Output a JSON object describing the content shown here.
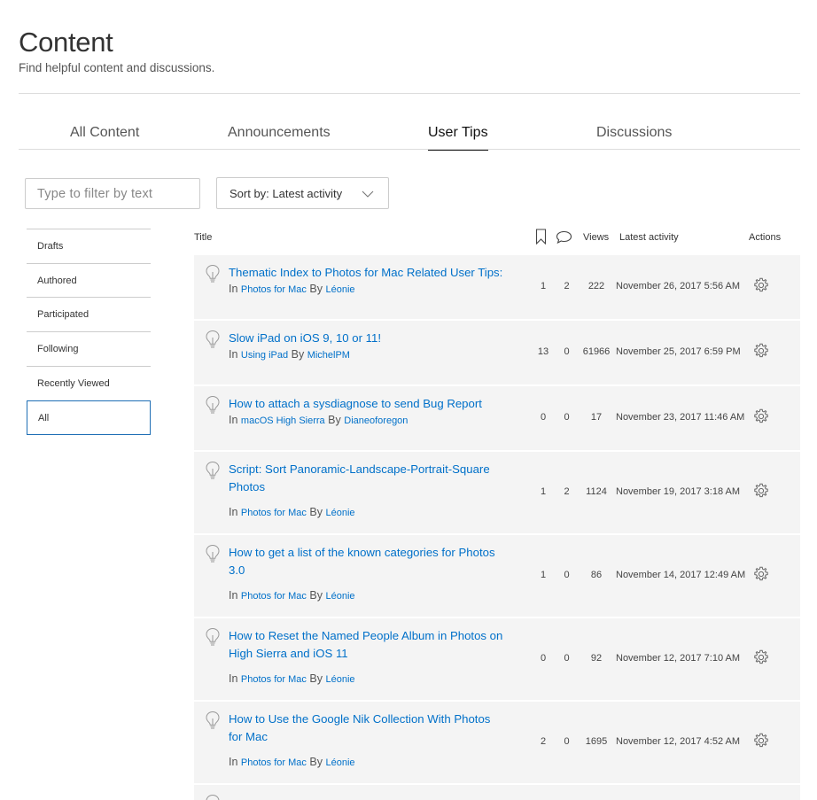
{
  "header": {
    "title": "Content",
    "subtitle": "Find helpful content and discussions."
  },
  "tabs": [
    {
      "label": "All Content",
      "active": false
    },
    {
      "label": "Announcements",
      "active": false
    },
    {
      "label": "User Tips",
      "active": true
    },
    {
      "label": "Discussions",
      "active": false
    }
  ],
  "filter": {
    "placeholder": "Type to filter by text",
    "value": ""
  },
  "sort": {
    "label": "Sort by: Latest activity"
  },
  "sidebar": {
    "items": [
      {
        "label": "Drafts"
      },
      {
        "label": "Authored"
      },
      {
        "label": "Participated"
      },
      {
        "label": "Following"
      },
      {
        "label": "Recently Viewed"
      },
      {
        "label": "All",
        "selected": true
      }
    ]
  },
  "table": {
    "headers": {
      "title": "Title",
      "bookmarks_icon": "bookmark-icon",
      "replies_icon": "comment-icon",
      "views": "Views",
      "latest_activity": "Latest activity",
      "actions": "Actions"
    },
    "rows": [
      {
        "title": "Thematic Index to Photos for Mac Related User Tips:",
        "in_label": "In",
        "community": "Photos for Mac",
        "by_label": "By",
        "author": "Léonie",
        "bookmarks": "1",
        "replies": "2",
        "views": "222",
        "latest": "November 26, 2017 5:56 AM"
      },
      {
        "title": "Slow iPad on iOS 9, 10 or 11!",
        "in_label": "In",
        "community": "Using iPad",
        "by_label": "By",
        "author": "MichelPM",
        "bookmarks": "13",
        "replies": "0",
        "views": "61966",
        "latest": "November 25, 2017 6:59 PM"
      },
      {
        "title": "How to attach a sysdiagnose to send Bug Report",
        "in_label": "In",
        "community": "macOS High Sierra",
        "by_label": "By",
        "author": "Dianeoforegon",
        "bookmarks": "0",
        "replies": "0",
        "views": "17",
        "latest": "November 23, 2017 11:46 AM"
      },
      {
        "title": "Script:  Sort Panoramic-Landscape-Portrait-Square Photos",
        "in_label": "In",
        "community": "Photos for Mac",
        "by_label": "By",
        "author": "Léonie",
        "bookmarks": "1",
        "replies": "2",
        "views": "1124",
        "latest": "November 19, 2017 3:18 AM"
      },
      {
        "title": "How to get a list of the known categories for Photos 3.0",
        "in_label": "In",
        "community": "Photos for Mac",
        "by_label": "By",
        "author": "Léonie",
        "bookmarks": "1",
        "replies": "0",
        "views": "86",
        "latest": "November 14, 2017 12:49 AM"
      },
      {
        "title": "How to Reset the Named People Album in Photos on High Sierra and iOS 11",
        "in_label": "In",
        "community": "Photos for Mac",
        "by_label": "By",
        "author": "Léonie",
        "bookmarks": "0",
        "replies": "0",
        "views": "92",
        "latest": "November 12, 2017 7:10 AM"
      },
      {
        "title": "How to Use the Google Nik Collection With Photos for Mac",
        "in_label": "In",
        "community": "Photos for Mac",
        "by_label": "By",
        "author": "Léonie",
        "bookmarks": "2",
        "replies": "0",
        "views": "1695",
        "latest": "November 12, 2017 4:52 AM"
      }
    ]
  },
  "colors": {
    "link": "#0070c9",
    "row_bg": "#f4f4f4",
    "selected_border": "#1f6fb5"
  }
}
